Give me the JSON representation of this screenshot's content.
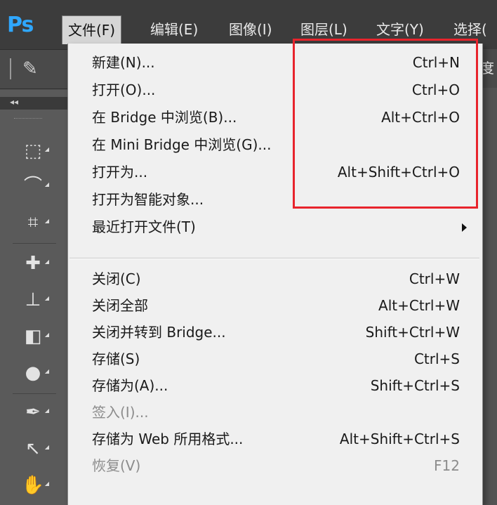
{
  "app": {
    "logo": "Ps"
  },
  "menubar": {
    "items": [
      {
        "label": "文件(F)",
        "active": true
      },
      {
        "label": "编辑(E)"
      },
      {
        "label": "图像(I)"
      },
      {
        "label": "图层(L)"
      },
      {
        "label": "文字(Y)"
      },
      {
        "label": "选择("
      }
    ]
  },
  "options_bar": {
    "right_fragment": "度"
  },
  "toolpanel": {
    "collapse_glyph": "◂◂",
    "tools": [
      {
        "name": "rect-marquee-icon",
        "glyph": "⬚"
      },
      {
        "name": "lasso-icon",
        "glyph": "⌒"
      },
      {
        "name": "crop-icon",
        "glyph": "⌗"
      },
      {
        "name": "healing-brush-icon",
        "glyph": "✚"
      },
      {
        "name": "stamp-icon",
        "glyph": "⊥"
      },
      {
        "name": "eraser-icon",
        "glyph": "◧"
      },
      {
        "name": "blur-drop-icon",
        "glyph": "●"
      },
      {
        "name": "pen-icon",
        "glyph": "✒"
      },
      {
        "name": "path-select-icon",
        "glyph": "↖"
      },
      {
        "name": "hand-icon",
        "glyph": "✋"
      }
    ]
  },
  "file_menu": {
    "items": [
      {
        "label": "新建(N)...",
        "shortcut": "Ctrl+N"
      },
      {
        "label": "打开(O)...",
        "shortcut": "Ctrl+O"
      },
      {
        "label": "在 Bridge 中浏览(B)...",
        "shortcut": "Alt+Ctrl+O"
      },
      {
        "label": "在 Mini Bridge 中浏览(G)...",
        "shortcut": ""
      },
      {
        "label": "打开为...",
        "shortcut": "Alt+Shift+Ctrl+O"
      },
      {
        "label": "打开为智能对象...",
        "shortcut": ""
      },
      {
        "label": "最近打开文件(T)",
        "shortcut": "",
        "submenu": true
      },
      {
        "label": "关闭(C)",
        "shortcut": "Ctrl+W"
      },
      {
        "label": "关闭全部",
        "shortcut": "Alt+Ctrl+W"
      },
      {
        "label": "关闭并转到 Bridge...",
        "shortcut": "Shift+Ctrl+W"
      },
      {
        "label": "存储(S)",
        "shortcut": "Ctrl+S"
      },
      {
        "label": "存储为(A)...",
        "shortcut": "Shift+Ctrl+S"
      },
      {
        "label": "签入(I)...",
        "shortcut": "",
        "disabled": true
      },
      {
        "label": "存储为 Web 所用格式...",
        "shortcut": "Alt+Shift+Ctrl+S"
      },
      {
        "label": "恢复(V)",
        "shortcut": "F12",
        "disabled": true
      }
    ]
  },
  "colors": {
    "highlight_box": "#e8242c",
    "menu_bg": "#f0f0f0",
    "app_bg": "#3c3c3c",
    "logo": "#2fa7ff"
  }
}
